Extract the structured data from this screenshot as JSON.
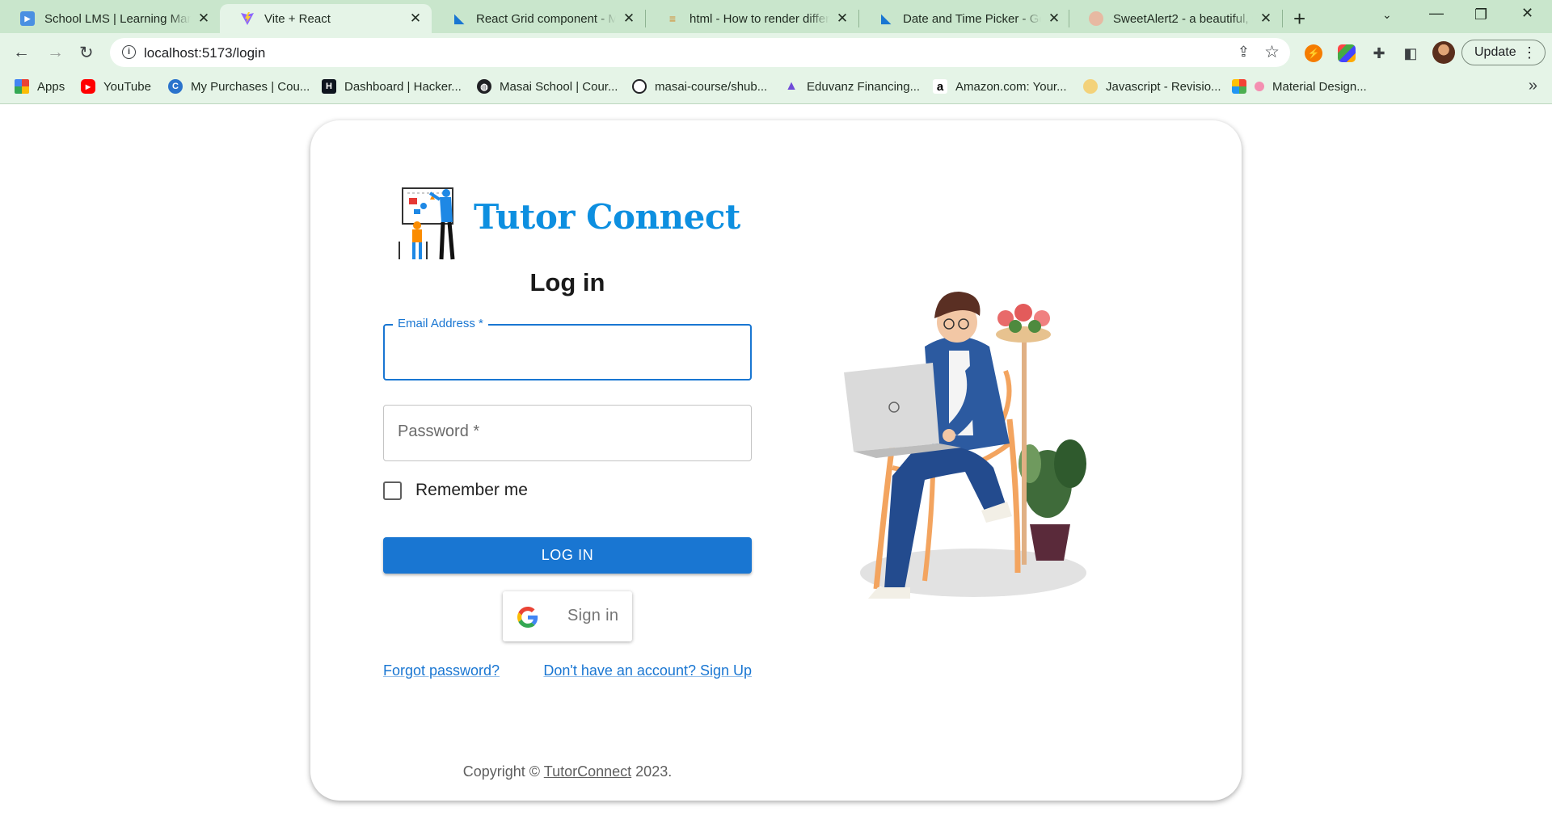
{
  "browser": {
    "tabs": [
      {
        "title": "School LMS | Learning Man",
        "favicon": "play-icon",
        "active": false
      },
      {
        "title": "Vite + React",
        "favicon": "vite-icon",
        "active": true
      },
      {
        "title": "React Grid component - Ma",
        "favicon": "mui-icon",
        "active": false
      },
      {
        "title": "html - How to render differ",
        "favicon": "stackoverflow-icon",
        "active": false
      },
      {
        "title": "Date and Time Picker - Get",
        "favicon": "mui-icon",
        "active": false
      },
      {
        "title": "SweetAlert2 - a beautiful, re",
        "favicon": "sweetalert-icon",
        "active": false
      }
    ],
    "url": "localhost:5173/login",
    "update_label": "Update",
    "bookmarks": [
      {
        "label": "Apps",
        "icon": "apps-grid-icon"
      },
      {
        "label": "YouTube",
        "icon": "youtube-icon"
      },
      {
        "label": "My Purchases | Cou...",
        "icon": "coursera-icon"
      },
      {
        "label": "Dashboard | Hacker...",
        "icon": "hackerrank-icon"
      },
      {
        "label": "Masai School | Cour...",
        "icon": "globe-icon"
      },
      {
        "label": "masai-course/shub...",
        "icon": "github-icon"
      },
      {
        "label": "Eduvanz Financing...",
        "icon": "eduvanz-icon"
      },
      {
        "label": "Amazon.com: Your...",
        "icon": "amazon-icon"
      },
      {
        "label": "Javascript - Revisio...",
        "icon": "javascript-icon"
      },
      {
        "label": "Material Design...",
        "icon": "material-icon"
      }
    ]
  },
  "page": {
    "brand": "Tutor Connect",
    "heading": "Log in",
    "email_label": "Email Address *",
    "password_placeholder": "Password *",
    "remember_label": "Remember me",
    "login_button": "LOG IN",
    "google_button": "Sign in",
    "forgot_link": "Forgot password?",
    "signup_link": "Don't have an account? Sign Up",
    "copyright_prefix": "Copyright ©",
    "copyright_brand": "TutorConnect",
    "copyright_year": "2023."
  },
  "colors": {
    "primary": "#1976d2",
    "brand": "#0d8fe0",
    "chrome_frame": "#c9e6cc",
    "chrome_toolbar": "#e5f4e7"
  }
}
